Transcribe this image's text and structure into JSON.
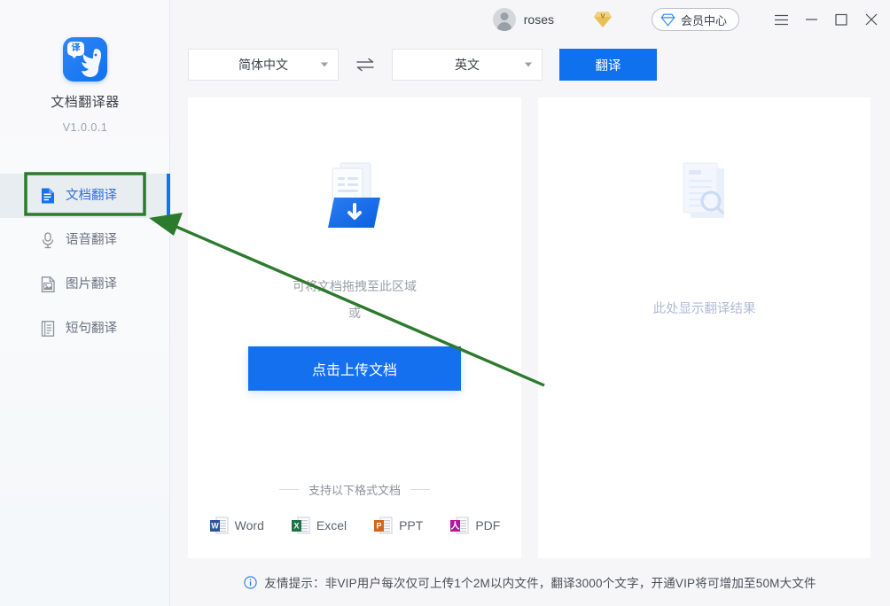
{
  "app": {
    "title": "文档翻译器",
    "version": "V1.0.0.1",
    "logo_badge": "译"
  },
  "sidebar": {
    "items": [
      {
        "label": "文档翻译",
        "icon": "document-icon",
        "active": true
      },
      {
        "label": "语音翻译",
        "icon": "microphone-icon",
        "active": false
      },
      {
        "label": "图片翻译",
        "icon": "image-icon",
        "active": false
      },
      {
        "label": "短句翻译",
        "icon": "text-lines-icon",
        "active": false
      }
    ]
  },
  "topbar": {
    "username": "roses",
    "vip_button_label": "会员中心",
    "menu_icon": "hamburger-icon",
    "minimize_icon": "minimize-icon",
    "maximize_icon": "maximize-icon",
    "close_icon": "close-icon",
    "vip_diamond_icon": "gold-diamond-icon"
  },
  "toolbar": {
    "source_language": "简体中文",
    "target_language": "英文",
    "swap_icon": "swap-arrows-icon",
    "translate_label": "翻译"
  },
  "left_panel": {
    "drop_line1": "可将文档拖拽至此区域",
    "drop_line2": "或",
    "upload_button_label": "点击上传文档",
    "formats_title": "支持以下格式文档",
    "formats": [
      {
        "label": "Word",
        "color": "#2a5699"
      },
      {
        "label": "Excel",
        "color": "#207245"
      },
      {
        "label": "PPT",
        "color": "#d24625"
      },
      {
        "label": "PDF",
        "color": "#b5179e"
      }
    ]
  },
  "right_panel": {
    "placeholder": "此处显示翻译结果"
  },
  "statusbar": {
    "info_icon": "info-circle-icon",
    "note": "友情提示：非VIP用户每次仅可上传1个2M以内文件，翻译3000个文字，开通VIP将可增加至50M大文件"
  },
  "annotations": {
    "highlight_color": "#2c7a2c",
    "arrow_color": "#2c7a2c"
  },
  "colors": {
    "accent": "#1071ef",
    "sidebar_active_bg": "#e7edf1",
    "page_bg": "#f6f6f8"
  }
}
